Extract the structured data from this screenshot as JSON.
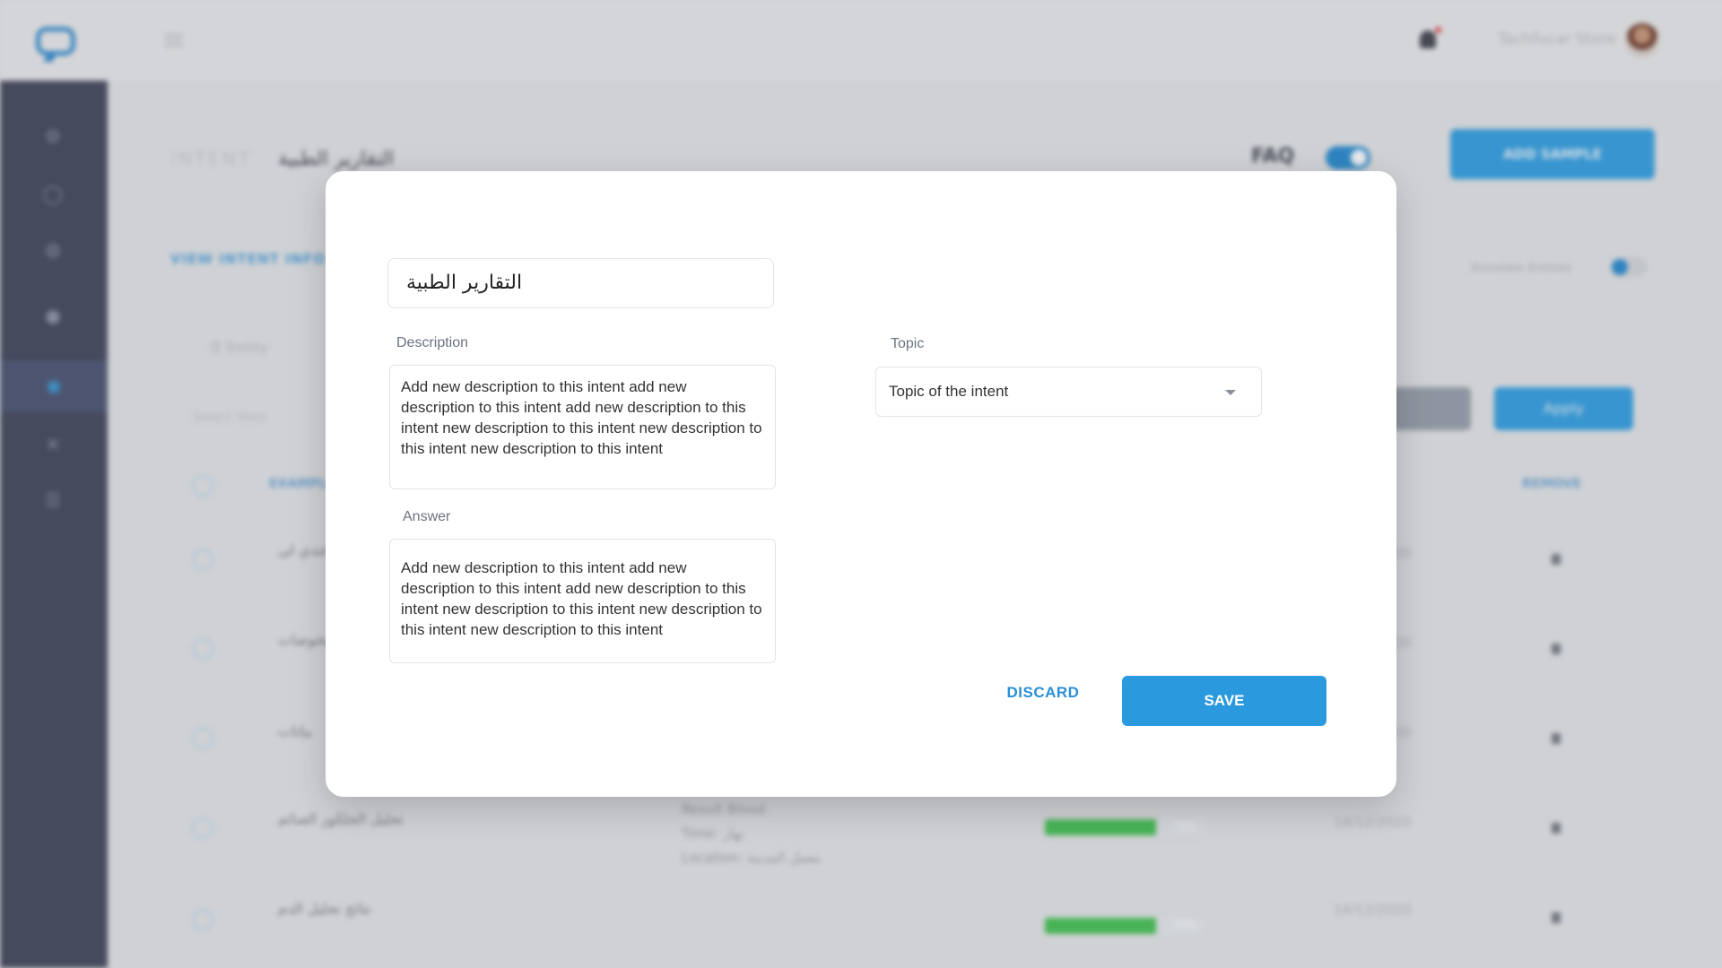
{
  "header": {
    "username": "Tachfucar Store"
  },
  "breadcrumb": {
    "root": "INTENT",
    "separator": ">",
    "current": "التقارير الطبية"
  },
  "faq": {
    "label": "FAQ",
    "enabled": true
  },
  "add_sample_label": "ADD SAMPLE",
  "view_intent_info_label": "VIEW INTENT INFO",
  "annotate_label": "Annotate Entities",
  "entity_filter_label": "Entity",
  "select_stats_label": "Select Stats",
  "apply_label": "Apply",
  "table": {
    "col_example": "EXAMPLE",
    "col_remove": "REMOVE",
    "rows": [
      {
        "text": "عندي لي",
        "date": "14/12/2020"
      },
      {
        "text": "نتائج الفحوصات",
        "date": "14/12/2020"
      },
      {
        "text": "بيانات",
        "date": "14/12/2020"
      },
      {
        "text": "تحليل الجلكوز الصائم",
        "date": "14/12/2020",
        "result": [
          "Result Blood",
          "Time: نهار",
          "Location: معمل المدينة"
        ],
        "progress_percent": 70,
        "progress_label": "70%"
      },
      {
        "text": "نتائج تحليل الدم",
        "date": "14/12/2020",
        "progress_percent": 70,
        "progress_label": "70%"
      }
    ]
  },
  "modal": {
    "intent_name": "التقارير الطبية",
    "description_label": "Description",
    "description_value": "Add new description to this intent add new description to this intent add new description to this intent new description to this intent new description to this intent new description to this intent",
    "answer_label": "Answer",
    "answer_value": "Add new description to this intent add new description to this intent add new description to this intent new description to this intent new description to this intent new description to this intent",
    "topic_label": "Topic",
    "topic_placeholder": "Topic of the intent",
    "discard_label": "DISCARD",
    "save_label": "SAVE"
  },
  "colors": {
    "primary": "#2b99de",
    "sidebar": "#4a4f63",
    "progress": "#4cc35a"
  }
}
